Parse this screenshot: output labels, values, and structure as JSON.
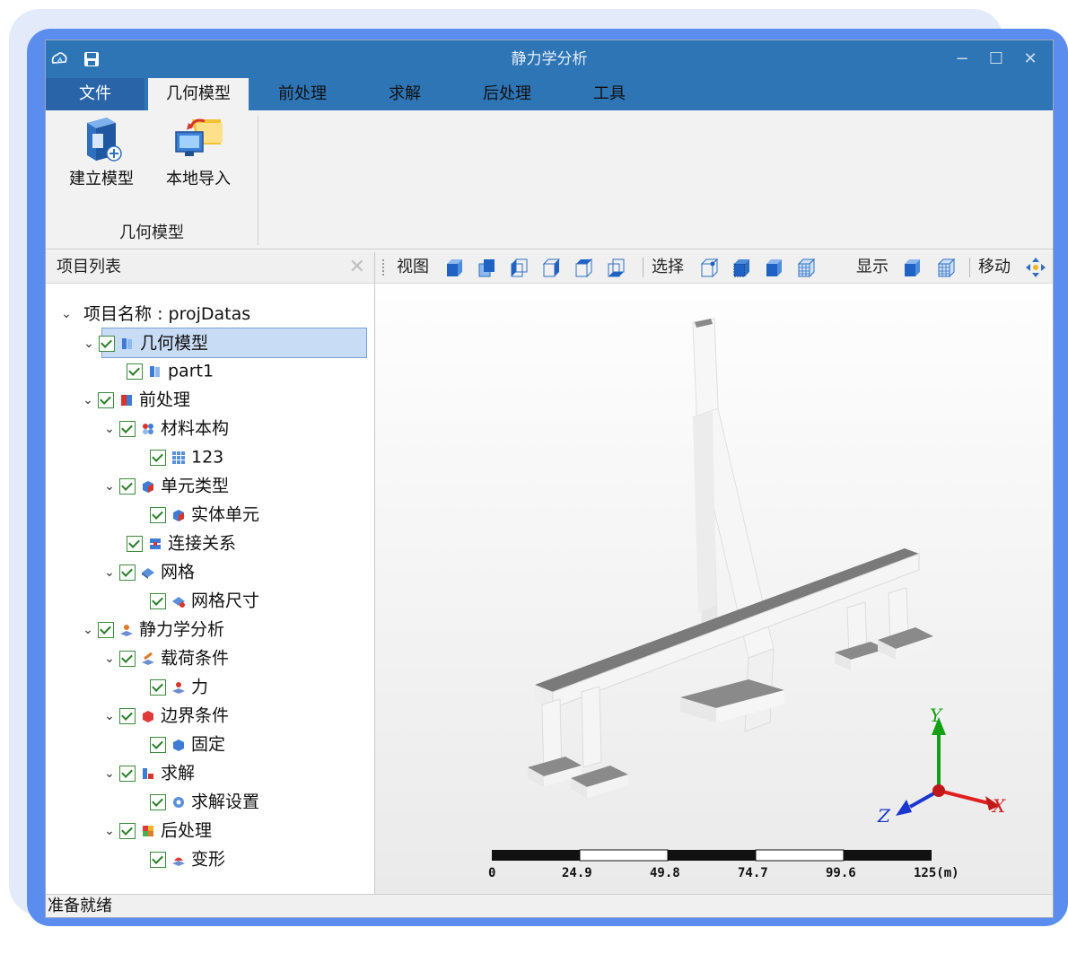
{
  "window": {
    "title": "静力学分析"
  },
  "menu": {
    "file": "文件",
    "tabs": [
      "几何模型",
      "前处理",
      "求解",
      "后处理",
      "工具"
    ]
  },
  "ribbon": {
    "buttons": [
      "建立模型",
      "本地导入"
    ],
    "group": "几何模型"
  },
  "project_panel": {
    "title": "项目列表",
    "root": "项目名称 : projDatas",
    "items": [
      {
        "label": "几何模型",
        "icon": "geometry-icon"
      },
      {
        "label": "part1",
        "icon": "part-icon"
      },
      {
        "label": "前处理",
        "icon": "preprocess-icon"
      },
      {
        "label": "材料本构",
        "icon": "material-icon"
      },
      {
        "label": "123",
        "icon": "grid-icon"
      },
      {
        "label": "单元类型",
        "icon": "element-type-icon"
      },
      {
        "label": "实体单元",
        "icon": "solid-element-icon"
      },
      {
        "label": "连接关系",
        "icon": "connection-icon"
      },
      {
        "label": "网格",
        "icon": "mesh-icon"
      },
      {
        "label": "网格尺寸",
        "icon": "mesh-size-icon"
      },
      {
        "label": "静力学分析",
        "icon": "static-analysis-icon"
      },
      {
        "label": "载荷条件",
        "icon": "load-icon"
      },
      {
        "label": "力",
        "icon": "force-icon"
      },
      {
        "label": "边界条件",
        "icon": "boundary-icon"
      },
      {
        "label": "固定",
        "icon": "fixed-icon"
      },
      {
        "label": "求解",
        "icon": "solve-icon"
      },
      {
        "label": "求解设置",
        "icon": "solve-settings-icon"
      },
      {
        "label": "后处理",
        "icon": "postprocess-icon"
      },
      {
        "label": "变形",
        "icon": "deformation-icon"
      }
    ]
  },
  "toolbar": {
    "view": "视图",
    "select": "选择",
    "display": "显示",
    "move": "移动"
  },
  "scale_bar": {
    "ticks": [
      "0",
      "24.9",
      "49.8",
      "74.7",
      "99.6",
      "125(m)"
    ]
  },
  "axes": {
    "x": "X",
    "y": "Y",
    "z": "Z"
  },
  "colors": {
    "titlebar": "#2e75b6",
    "accent": "#5b8def",
    "deck": "#7a7a7a"
  },
  "status": "准备就绪"
}
